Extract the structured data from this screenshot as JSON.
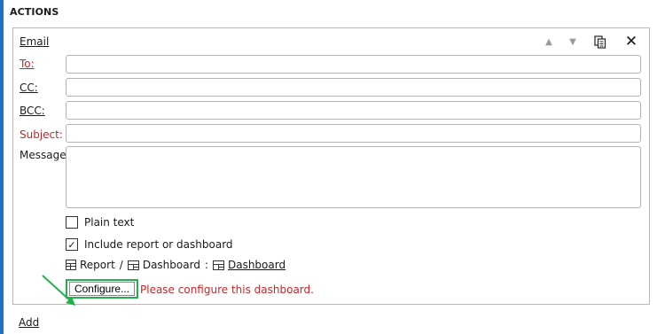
{
  "section": {
    "title": "ACTIONS"
  },
  "email": {
    "header": "Email",
    "labels": {
      "to": "To:",
      "cc": "CC:",
      "bcc": "BCC:",
      "subject": "Subject:",
      "message": "Message:"
    },
    "values": {
      "to": "",
      "cc": "",
      "bcc": "",
      "subject": "",
      "message": ""
    },
    "plain_text": {
      "label": "Plain text",
      "checked": false
    },
    "include_report": {
      "label": "Include report or dashboard",
      "checked": true,
      "check_glyph": "✓"
    },
    "report_path": {
      "report": "Report",
      "separator": "/",
      "dashboard": "Dashboard",
      "colon": ":",
      "dashboard_link": "Dashboard"
    },
    "configure_button": "Configure...",
    "warning": "Please configure this dashboard."
  },
  "header_icons": {
    "move_up": "▲",
    "move_down": "▼",
    "copy": "⧉",
    "close": "✕"
  },
  "add_label": "Add",
  "colors": {
    "accent_bar": "#1f6fc2",
    "required_red": "#c0282b",
    "highlight_green": "#22b04b"
  }
}
